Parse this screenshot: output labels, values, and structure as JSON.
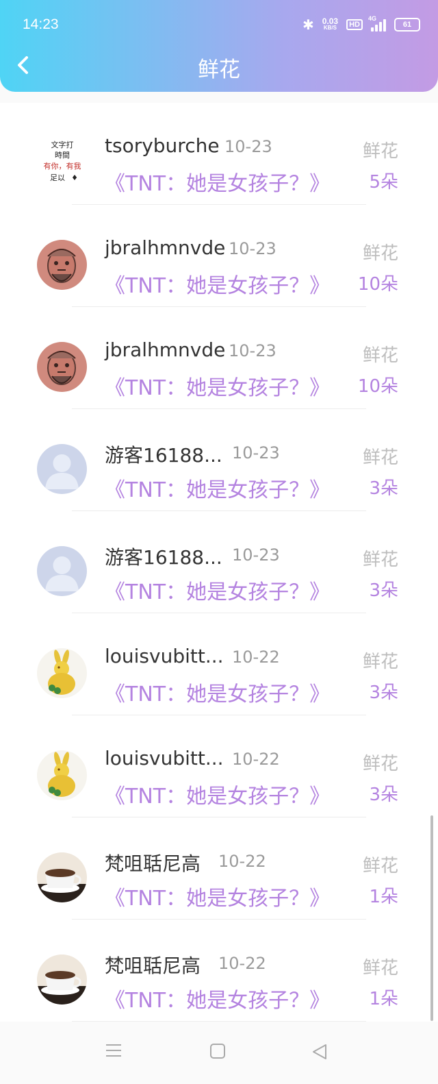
{
  "status_bar": {
    "time": "14:23",
    "net_speed": "0.03",
    "net_unit": "KB/S",
    "hd": "HD",
    "network": "4G",
    "battery": "61"
  },
  "header": {
    "title": "鲜花"
  },
  "items": [
    {
      "name": "tsoryburche",
      "date": "10-23",
      "book": "《TNT：她是女孩子？》",
      "label": "鲜花",
      "count": "5朵",
      "avatar": "text-image",
      "avatar_text": [
        "文字打",
        "時間",
        "有你，有我",
        "足以"
      ]
    },
    {
      "name": "jbralhmnvde",
      "date": "10-23",
      "book": "《TNT：她是女孩子？》",
      "label": "鲜花",
      "count": "10朵",
      "avatar": "warrior-portrait"
    },
    {
      "name": "jbralhmnvde",
      "date": "10-23",
      "book": "《TNT：她是女孩子？》",
      "label": "鲜花",
      "count": "10朵",
      "avatar": "warrior-portrait"
    },
    {
      "name": "游客16188...",
      "date": "10-23",
      "book": "《TNT：她是女孩子？》",
      "label": "鲜花",
      "count": "3朵",
      "avatar": "default-user"
    },
    {
      "name": "游客16188...",
      "date": "10-23",
      "book": "《TNT：她是女孩子？》",
      "label": "鲜花",
      "count": "3朵",
      "avatar": "default-user"
    },
    {
      "name": "louisvubitt...",
      "date": "10-22",
      "book": "《TNT：她是女孩子？》",
      "label": "鲜花",
      "count": "3朵",
      "avatar": "gold-rabbit"
    },
    {
      "name": "louisvubitt...",
      "date": "10-22",
      "book": "《TNT：她是女孩子？》",
      "label": "鲜花",
      "count": "3朵",
      "avatar": "gold-rabbit"
    },
    {
      "name": "梵咀聒尼高",
      "date": "10-22",
      "book": "《TNT：她是女孩子？》",
      "label": "鲜花",
      "count": "1朵",
      "avatar": "coffee-cup"
    },
    {
      "name": "梵咀聒尼高",
      "date": "10-22",
      "book": "《TNT：她是女孩子？》",
      "label": "鲜花",
      "count": "1朵",
      "avatar": "coffee-cup"
    }
  ],
  "colors": {
    "gradient_start": "#4fd4f5",
    "gradient_end": "#c39be4",
    "accent_purple": "#b483e0",
    "muted_gray": "#9a9a9a"
  }
}
